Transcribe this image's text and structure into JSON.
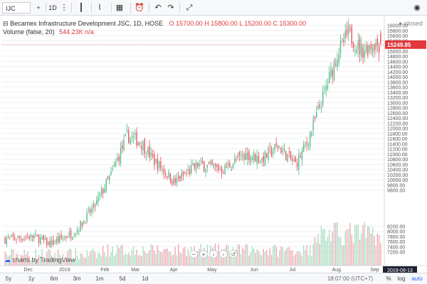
{
  "toolbar": {
    "symbol": "IJC",
    "interval": "1D",
    "icons": [
      "compare-add-icon",
      "candle-style-icon",
      "indicators-icon",
      "templates-icon",
      "alert-icon",
      "replay-icon",
      "undo-icon",
      "redo-icon",
      "fullscreen-icon",
      "snapshot-icon"
    ]
  },
  "legend": {
    "title": "Becamex Infrastructure Development JSC, 1D, HOSE",
    "ohlc": "O 15700.00  H 15800.00  L 15200.00  C 15300.00",
    "volume_label": "Volume (false, 20)",
    "volume_value": "544.23K  n/a"
  },
  "status": "closed",
  "price_label": "15249.85",
  "date_label": "2019-09-13",
  "watermark": "charts by TradingView",
  "bottom": {
    "ranges": [
      "5y",
      "1y",
      "6m",
      "3m",
      "1m",
      "5d",
      "1d"
    ],
    "clock": "18:07:00 (UTC+7)",
    "toggles": [
      "%",
      "log",
      "auto"
    ]
  },
  "colors": {
    "up": "#53b987",
    "down": "#eb4d5c",
    "vol_up": "#a9dcc3",
    "vol_down": "#f5a6ae",
    "grid": "#eef0f3"
  },
  "chart_data": {
    "type": "candlestick",
    "title": "Becamex Infrastructure Development JSC, 1D, HOSE",
    "x_ticks": [
      "Dec",
      "2019",
      "Feb",
      "Mar",
      "Apr",
      "May",
      "Jun",
      "Jul",
      "Aug",
      "Sep"
    ],
    "y_ticks": [
      7200,
      7400,
      7600,
      7800,
      8000,
      8200,
      9600,
      9800,
      10000,
      10200,
      10400,
      10600,
      10800,
      11000,
      11200,
      11400,
      11600,
      11800,
      12000,
      12200,
      12400,
      12600,
      12800,
      13000,
      13200,
      13400,
      13600,
      13800,
      14000,
      14200,
      14400,
      14600,
      14800,
      15000,
      15200,
      15400,
      15600,
      15800,
      16000
    ],
    "ylim": [
      7000,
      16100
    ],
    "anchor_close": [
      [
        0,
        7700
      ],
      [
        18,
        7800
      ],
      [
        28,
        7500
      ],
      [
        44,
        8000
      ],
      [
        56,
        9000
      ],
      [
        66,
        10200
      ],
      [
        76,
        11700
      ],
      [
        84,
        11500
      ],
      [
        92,
        10800
      ],
      [
        106,
        9900
      ],
      [
        120,
        10600
      ],
      [
        136,
        10400
      ],
      [
        150,
        11000
      ],
      [
        160,
        10800
      ],
      [
        170,
        11300
      ],
      [
        181,
        10600
      ],
      [
        188,
        11400
      ],
      [
        198,
        13200
      ],
      [
        207,
        14900
      ],
      [
        214,
        15700
      ],
      [
        222,
        15000
      ],
      [
        230,
        15300
      ],
      [
        234,
        15200
      ]
    ],
    "last_ohlc": {
      "open": 15700,
      "high": 15800,
      "low": 15200,
      "close": 15300
    }
  }
}
